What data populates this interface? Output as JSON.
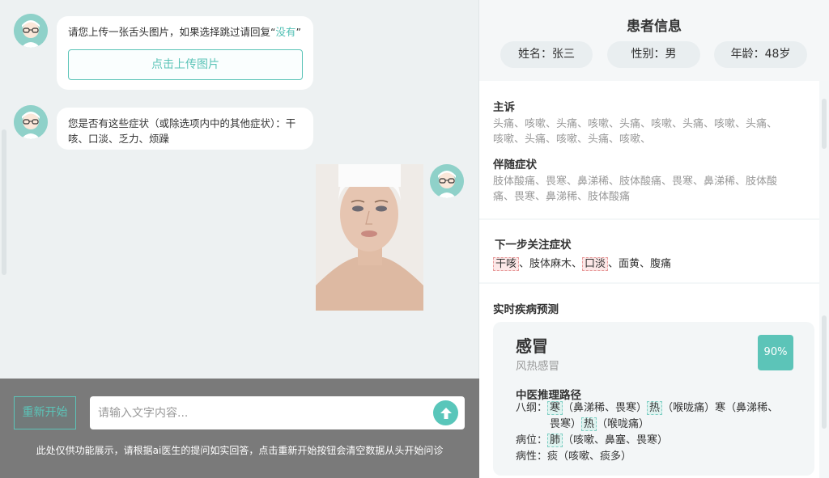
{
  "chat": {
    "msg1": {
      "text_before": "请您上传一张舌头图片，如果选择跳过请回复“",
      "text_highlight": "没有",
      "text_after": "”",
      "upload_label": "点击上传图片"
    },
    "msg2": {
      "line1": "您是否有这些症状（或除选项内中的其他症状）：干",
      "line2": "咳、口淡、乏力、烦躁"
    },
    "restart_label": "重新开始",
    "input_placeholder": "请输入文字内容...",
    "disclaimer": "此处仅供功能展示，请根据ai医生的提问如实回答，点击重新开始按钮会清空数据从头开始问诊"
  },
  "patient": {
    "title": "患者信息",
    "name": "姓名：张三",
    "gender": "性别：男",
    "age": "年龄：48岁"
  },
  "complaint": {
    "title": "主诉",
    "line1": "头痛、咳嗽、头痛、咳嗽、头痛、咳嗽、头痛、咳嗽、头痛、",
    "line2": "咳嗽、头痛、咳嗽、头痛、咳嗽、"
  },
  "accompany": {
    "title": "伴随症状",
    "line1": "肢体酸痛、畏寒、鼻涕稀、肢体酸痛、畏寒、鼻涕稀、肢体酸",
    "line2": "痛、畏寒、鼻涕稀、肢体酸痛"
  },
  "next_focus": {
    "title": "下一步关注症状",
    "tag1": "干咳",
    "sep1": "、肢体麻木、",
    "tag2": "口淡",
    "rest": "、面黄、腹痛"
  },
  "prediction": {
    "title": "实时疾病预测",
    "disease": "感冒",
    "subtype": "风热感冒",
    "percent": "90%",
    "path_title": "中医推理路径",
    "bagang_label": "八纲：",
    "bagang_tag1": "寒",
    "bagang_t1": "（鼻涕稀、畏寒）",
    "bagang_tag2": "热",
    "bagang_t2": "（喉咙痛）寒（鼻涕稀、",
    "bagang_l2a": "畏寒）",
    "bagang_tag3": "热",
    "bagang_l2b": "（喉咙痛）",
    "bingwei_label": "病位：",
    "bingwei_tag": "肺",
    "bingwei_text": "（咳嗽、鼻塞、畏寒）",
    "bingxing": "病性：痰（咳嗽、痰多）"
  },
  "colors": {
    "accent": "#5cc4b8",
    "bottom_bar": "#7a7a7a"
  }
}
